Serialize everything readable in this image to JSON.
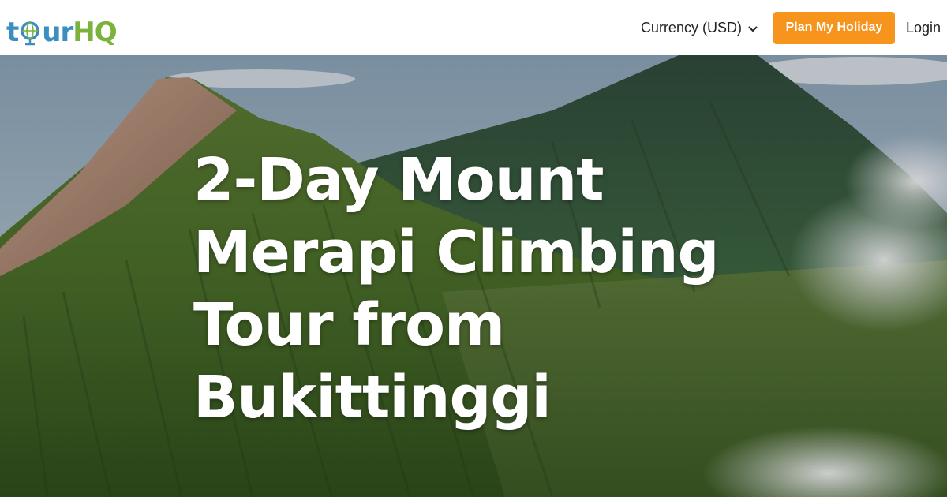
{
  "logo": {
    "part_1": "t",
    "part_2": "ur",
    "part_3": "HQ",
    "globe_icon": "globe-icon"
  },
  "nav": {
    "currency_label": "Currency (USD)",
    "currency_icon": "chevron-down-icon",
    "plan_button": "Plan My Holiday",
    "login": "Login"
  },
  "hero": {
    "title": "2-Day Mount Merapi Climbing Tour from Bukittinggi"
  },
  "colors": {
    "accent": "#f7941d",
    "logo_blue": "#3a8fc0",
    "logo_green": "#7ab23b"
  }
}
